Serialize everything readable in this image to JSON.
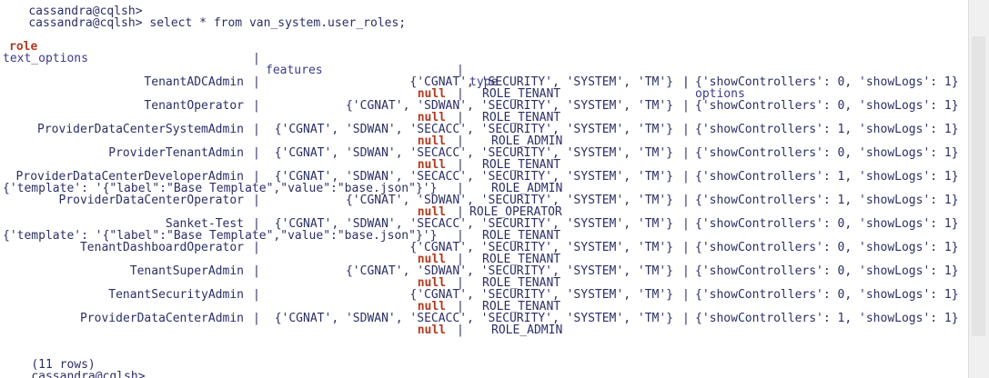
{
  "terminal": {
    "prev_prompt": "cassandra@cqlsh>",
    "prompt": "cassandra@cqlsh>",
    "command": " select * from van_system.user_roles;",
    "header": {
      "role": "role",
      "features": "features",
      "options": "options",
      "text_options": "text_options",
      "type": "type"
    },
    "separator1": "-------------------------------------------------------------------------------------------------------------------------------------------------------------------------------+-------------------------------------------------------------------------------------------------------------------------+",
    "separator2": "------------------------------------------------------------------------------------------------------------------------------+",
    "rows": [
      {
        "role": "TenantADCAdmin",
        "features": "{'CGNAT', 'SECURITY', 'SYSTEM', 'TM'}",
        "options": "{'showControllers': 0, 'showLogs': 1}",
        "text_options": "null",
        "type": "ROLE_TENANT"
      },
      {
        "role": "TenantOperator",
        "features": "{'CGNAT', 'SDWAN', 'SECURITY', 'SYSTEM', 'TM'}",
        "options": "{'showControllers': 0, 'showLogs': 1}",
        "text_options": "null",
        "type": "ROLE_TENANT"
      },
      {
        "role": "ProviderDataCenterSystemAdmin",
        "features": "{'CGNAT', 'SDWAN', 'SECACC', 'SECURITY', 'SYSTEM', 'TM'}",
        "options": "{'showControllers': 1, 'showLogs': 1}",
        "text_options": "null",
        "type": "ROLE_ADMIN"
      },
      {
        "role": "ProviderTenantAdmin",
        "features": "{'CGNAT', 'SDWAN', 'SECACC', 'SECURITY', 'SYSTEM', 'TM'}",
        "options": "{'showControllers': 0, 'showLogs': 1}",
        "text_options": "null",
        "type": "ROLE_TENANT"
      },
      {
        "role": "ProviderDataCenterDeveloperAdmin",
        "features": "{'CGNAT', 'SDWAN', 'SECACC', 'SECURITY', 'SYSTEM', 'TM'}",
        "options": "{'showControllers': 1, 'showLogs': 1}",
        "text_options": "{'template': '{\"label\":\"Base Template\",\"value\":\"base.json\"}'}",
        "type": "ROLE_ADMIN"
      },
      {
        "role": "ProviderDataCenterOperator",
        "features": "{'CGNAT', 'SDWAN', 'SECURITY', 'SYSTEM', 'TM'}",
        "options": "{'showControllers': 1, 'showLogs': 1}",
        "text_options": "null",
        "type": "ROLE_OPERATOR"
      },
      {
        "role": "Sanket-Test",
        "features": "{'CGNAT', 'SDWAN', 'SECACC', 'SECURITY', 'SYSTEM', 'TM'}",
        "options": "{'showControllers': 0, 'showLogs': 1}",
        "text_options": "{'template': '{\"label\":\"Base Template\",\"value\":\"base.json\"}'}",
        "type": "ROLE_TENANT"
      },
      {
        "role": "TenantDashboardOperator",
        "features": "{'CGNAT', 'SECURITY', 'SYSTEM', 'TM'}",
        "options": "{'showControllers': 0, 'showLogs': 1}",
        "text_options": "null",
        "type": "ROLE_TENANT"
      },
      {
        "role": "TenantSuperAdmin",
        "features": "{'CGNAT', 'SDWAN', 'SECURITY', 'SYSTEM', 'TM'}",
        "options": "{'showControllers': 0, 'showLogs': 1}",
        "text_options": "null",
        "type": "ROLE_TENANT"
      },
      {
        "role": "TenantSecurityAdmin",
        "features": "{'CGNAT', 'SECURITY', 'SYSTEM', 'TM'}",
        "options": "{'showControllers': 0, 'showLogs': 1}",
        "text_options": "null",
        "type": "ROLE_TENANT"
      },
      {
        "role": "ProviderDataCenterAdmin",
        "features": "{'CGNAT', 'SDWAN', 'SECACC', 'SECURITY', 'SYSTEM', 'TM'}",
        "options": "{'showControllers': 1, 'showLogs': 1}",
        "text_options": "null",
        "type": "ROLE_ADMIN"
      }
    ],
    "row_count": "(11 rows)"
  }
}
